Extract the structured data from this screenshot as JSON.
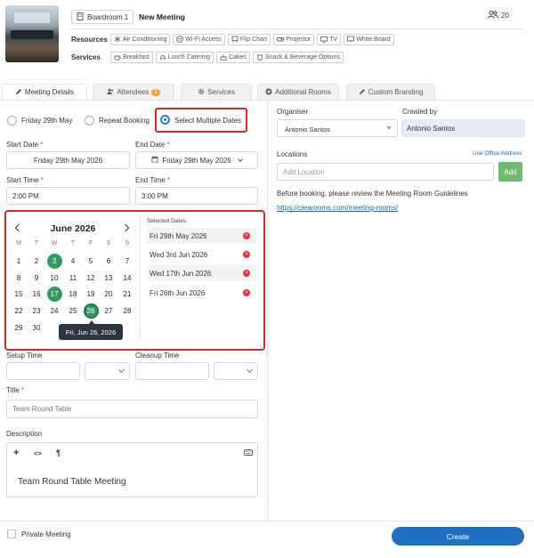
{
  "header": {
    "room_name": "Boardroom 1",
    "title": "New Meeting",
    "capacity": "20",
    "resources_label": "Resources",
    "services_label": "Services",
    "resources": [
      "Air Conditioning",
      "Wi-Fi Access",
      "Flip Chart",
      "Projector",
      "TV",
      "White Board"
    ],
    "services": [
      "Breakfast",
      "Lunch Catering",
      "Cakes",
      "Snack & Beverage Options"
    ]
  },
  "tabs": {
    "meeting_details": "Meeting Details",
    "attendees": "Attendees",
    "attendees_count": "1",
    "services": "Services",
    "additional_rooms": "Additional Rooms",
    "custom_branding": "Custom Branding"
  },
  "booking_type": {
    "option1": "Friday 29th May",
    "option2": "Repeat Booking",
    "option3": "Select Multiple Dates"
  },
  "form": {
    "start_date_label": "Start Date",
    "start_date_value": "Friday 29th May 2026",
    "end_date_label": "End Date",
    "end_date_value": "Friday 29th May 2026",
    "start_time_label": "Start Time",
    "start_time_value": "2:00 PM",
    "end_time_label": "End Time",
    "end_time_value": "3:00 PM",
    "required_mark": "*",
    "setup_time_label": "Setup Time",
    "cleanup_time_label": "Cleanup Time",
    "title_label": "Title",
    "title_placeholder": "Team Round Table",
    "description_label": "Description",
    "description_value": "Team Round Table Meeting"
  },
  "calendar": {
    "month": "June 2026",
    "dows": [
      "M",
      "T",
      "W",
      "T",
      "F",
      "S",
      "S"
    ],
    "weeks": [
      [
        "1",
        "2",
        "3",
        "4",
        "5",
        "6",
        "7"
      ],
      [
        "8",
        "9",
        "10",
        "11",
        "12",
        "13",
        "14"
      ],
      [
        "15",
        "16",
        "17",
        "18",
        "19",
        "20",
        "21"
      ],
      [
        "22",
        "23",
        "24",
        "25",
        "26",
        "27",
        "28"
      ],
      [
        "29",
        "30",
        "",
        "",
        "",
        "",
        ""
      ]
    ],
    "selected_days": [
      "3",
      "17",
      "26"
    ],
    "tooltip": "Fri, Jun 26, 2026",
    "selected_label": "Selected Dates",
    "selected_dates": [
      "Fri 29th May 2026",
      "Wed 3rd Jun 2026",
      "Wed 17th Jun 2026",
      "Fri 26th Jun 2026"
    ]
  },
  "right": {
    "organiser_label": "Organiser",
    "organiser_value": "Antonio Santos",
    "created_by_label": "Created by",
    "created_by_value": "Antonio Santos",
    "locations_label": "Locations",
    "use_office_address": "Use Office Address",
    "add_location_placeholder": "Add Location",
    "add_button": "Add",
    "guidelines_text": "Before booking, please review the Meeting Room Guidelines",
    "guidelines_link": "https://clearooms.com/meeting-rooms/"
  },
  "footer": {
    "private_meeting": "Private Meeting",
    "create_button": "Create"
  },
  "colors": {
    "accent": "#2a7bd6",
    "selected_day": "#2f9a5f",
    "add_button": "#6dbb6d",
    "highlight": "#d9262e",
    "create_button": "#1f6fc2"
  }
}
